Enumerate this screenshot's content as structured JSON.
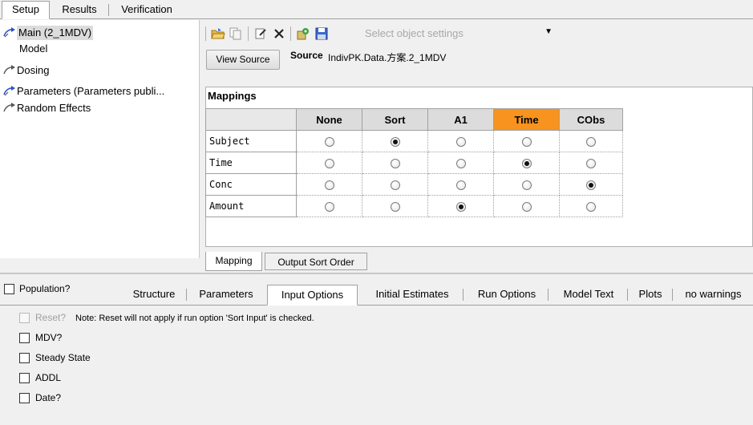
{
  "top_tabs": [
    {
      "label": "Setup",
      "active": true
    },
    {
      "label": "Results",
      "active": false
    },
    {
      "label": "Verification",
      "active": false
    }
  ],
  "tree": {
    "items": [
      {
        "label": "Main (2_1MDV)",
        "icon": "link-arrow-icon",
        "selected": true
      },
      {
        "label": "Model",
        "icon": "",
        "selected": false
      },
      {
        "label": "Dosing",
        "icon": "link-arrow-icon",
        "selected": false
      },
      {
        "label": "Parameters (Parameters publi...",
        "icon": "link-arrow-icon",
        "selected": false
      },
      {
        "label": "Random Effects",
        "icon": "link-arrow-icon",
        "selected": false
      }
    ]
  },
  "toolbar": {
    "icons": [
      "open-folder-icon",
      "copy-icon",
      "edit-icon",
      "delete-icon",
      "settings-icon",
      "save-icon"
    ],
    "select_placeholder": "Select object settings"
  },
  "source": {
    "button_label": "View Source",
    "label": "Source",
    "value": "IndivPK.Data.方案.2_1MDV"
  },
  "mappings": {
    "title": "Mappings",
    "columns": [
      "None",
      "Sort",
      "A1",
      "Time",
      "CObs"
    ],
    "highlighted_column": 3,
    "rows": [
      {
        "label": "Subject",
        "selected": 1
      },
      {
        "label": "Time",
        "selected": 3
      },
      {
        "label": "Conc",
        "selected": 4
      },
      {
        "label": "Amount",
        "selected": 2
      }
    ]
  },
  "bottom_tabs": [
    {
      "label": "Mapping",
      "active": true
    },
    {
      "label": "Output Sort Order",
      "active": false
    }
  ],
  "population_label": "Population?",
  "lower_tabs": [
    {
      "label": "Structure",
      "active": false
    },
    {
      "label": "Parameters",
      "active": false
    },
    {
      "label": "Input Options",
      "active": true
    },
    {
      "label": "Initial Estimates",
      "active": false
    },
    {
      "label": "Run Options",
      "active": false
    },
    {
      "label": "Model Text",
      "active": false
    },
    {
      "label": "Plots",
      "active": false
    },
    {
      "label": "no warnings",
      "active": false
    }
  ],
  "input_options": {
    "reset_label": "Reset?",
    "reset_note": "Note: Reset will not apply if run option 'Sort Input' is checked.",
    "options": [
      {
        "label": "MDV?",
        "checked": false
      },
      {
        "label": "Steady State",
        "checked": false
      },
      {
        "label": "ADDL",
        "checked": false
      },
      {
        "label": "Date?",
        "checked": false
      }
    ]
  }
}
